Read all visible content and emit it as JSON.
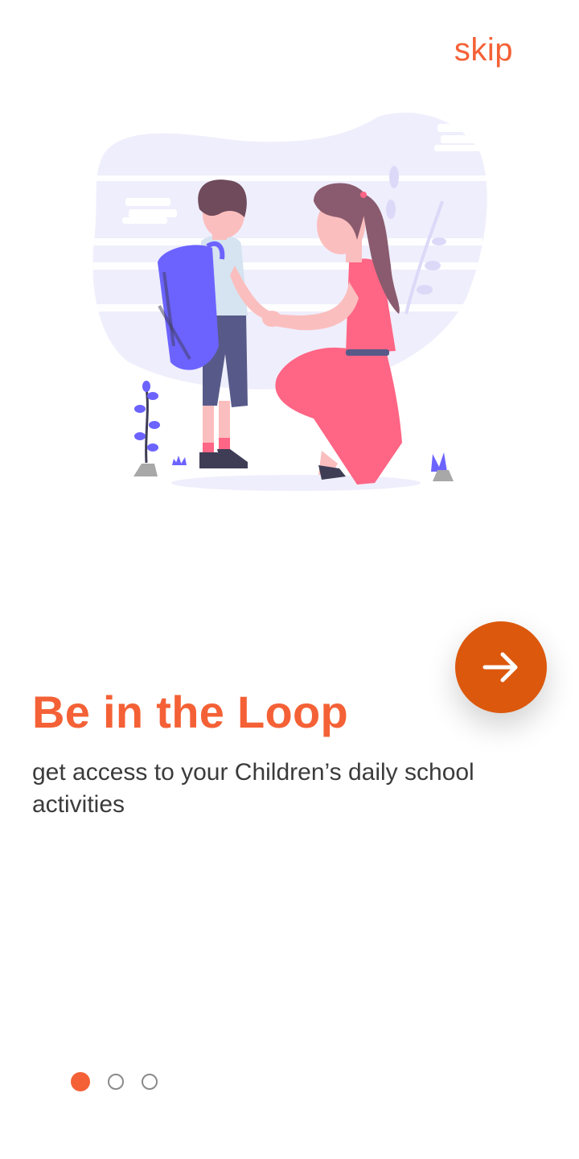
{
  "header": {
    "skip_label": "skip"
  },
  "illustration": {
    "name": "parent-and-child-illustration"
  },
  "content": {
    "title": "Be in the Loop",
    "subtitle": "get access to your Children’s daily school activities"
  },
  "next_button": {
    "icon": "arrow-right-icon"
  },
  "pagination": {
    "total": 3,
    "active_index": 0
  },
  "colors": {
    "accent": "#f46136",
    "button": "#dc580d",
    "text": "#3b3b3b",
    "illustration_bg": "#efeefc",
    "backpack": "#6c63ff",
    "dress": "#ff6584"
  }
}
